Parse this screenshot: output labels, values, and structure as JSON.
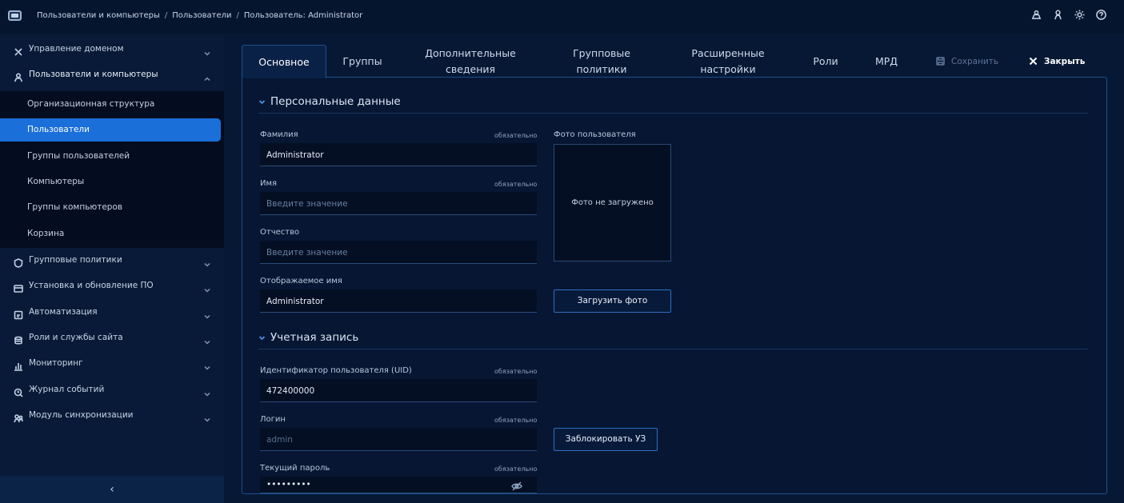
{
  "header": {
    "breadcrumb": [
      "Пользователи и компьютеры",
      "Пользователи",
      "Пользователь: Administrator"
    ],
    "separator": "/",
    "icons": [
      "users-icon",
      "user-icon",
      "theme-icon",
      "help-icon"
    ]
  },
  "sidebar": {
    "groups": [
      {
        "label": "Управление доменом",
        "icon": "tools-icon"
      },
      {
        "label": "Пользователи и компьютеры",
        "icon": "user-icon"
      },
      {
        "label": "Групповые политики",
        "icon": "shield-icon"
      },
      {
        "label": "Установка и обновление ПО",
        "icon": "package-icon"
      },
      {
        "label": "Автоматизация",
        "icon": "automation-icon"
      },
      {
        "label": "Роли и службы сайта",
        "icon": "database-icon"
      },
      {
        "label": "Мониторинг",
        "icon": "chart-icon"
      },
      {
        "label": "Журнал событий",
        "icon": "log-icon"
      },
      {
        "label": "Модуль синхронизации",
        "icon": "sync-icon"
      }
    ],
    "subitems": [
      "Организационная структура",
      "Пользователи",
      "Группы пользователей",
      "Компьютеры",
      "Группы компьютеров",
      "Корзина"
    ],
    "active_subitem": "Пользователи",
    "collapse_glyph": "‹"
  },
  "tabs": {
    "items": [
      {
        "line1": "Основное",
        "line2": ""
      },
      {
        "line1": "Группы",
        "line2": ""
      },
      {
        "line1": "Дополнительные",
        "line2": "сведения"
      },
      {
        "line1": "Групповые",
        "line2": "политики"
      },
      {
        "line1": "Расширенные",
        "line2": "настройки"
      },
      {
        "line1": "Роли",
        "line2": ""
      },
      {
        "line1": "МРД",
        "line2": ""
      }
    ],
    "active": "Основное",
    "save_label": "Сохранить",
    "close_label": "Закрыть"
  },
  "personal": {
    "title": "Персональные данные",
    "required_label": "обязательно",
    "last_name_label": "Фамилия",
    "last_name_value": "Administrator",
    "first_name_label": "Имя",
    "first_name_placeholder": "Введите значение",
    "middle_name_label": "Отчество",
    "middle_name_placeholder": "Введите значение",
    "display_name_label": "Отображаемое имя",
    "display_name_value": "Administrator",
    "photo_label": "Фото пользователя",
    "photo_empty": "Фото не загружено",
    "upload_button": "Загрузить фото"
  },
  "account": {
    "title": "Учетная запись",
    "required_label": "обязательно",
    "uid_label": "Идентификатор пользователя (UID)",
    "uid_value": "472400000",
    "login_label": "Логин",
    "login_value": "admin",
    "password_label": "Текущий пароль",
    "password_value": "•••••••••",
    "lock_button": "Заблокировать УЗ"
  },
  "colors": {
    "background": "#071834",
    "accent": "#1a6fd9",
    "panel_border": "#1b4f8d"
  }
}
